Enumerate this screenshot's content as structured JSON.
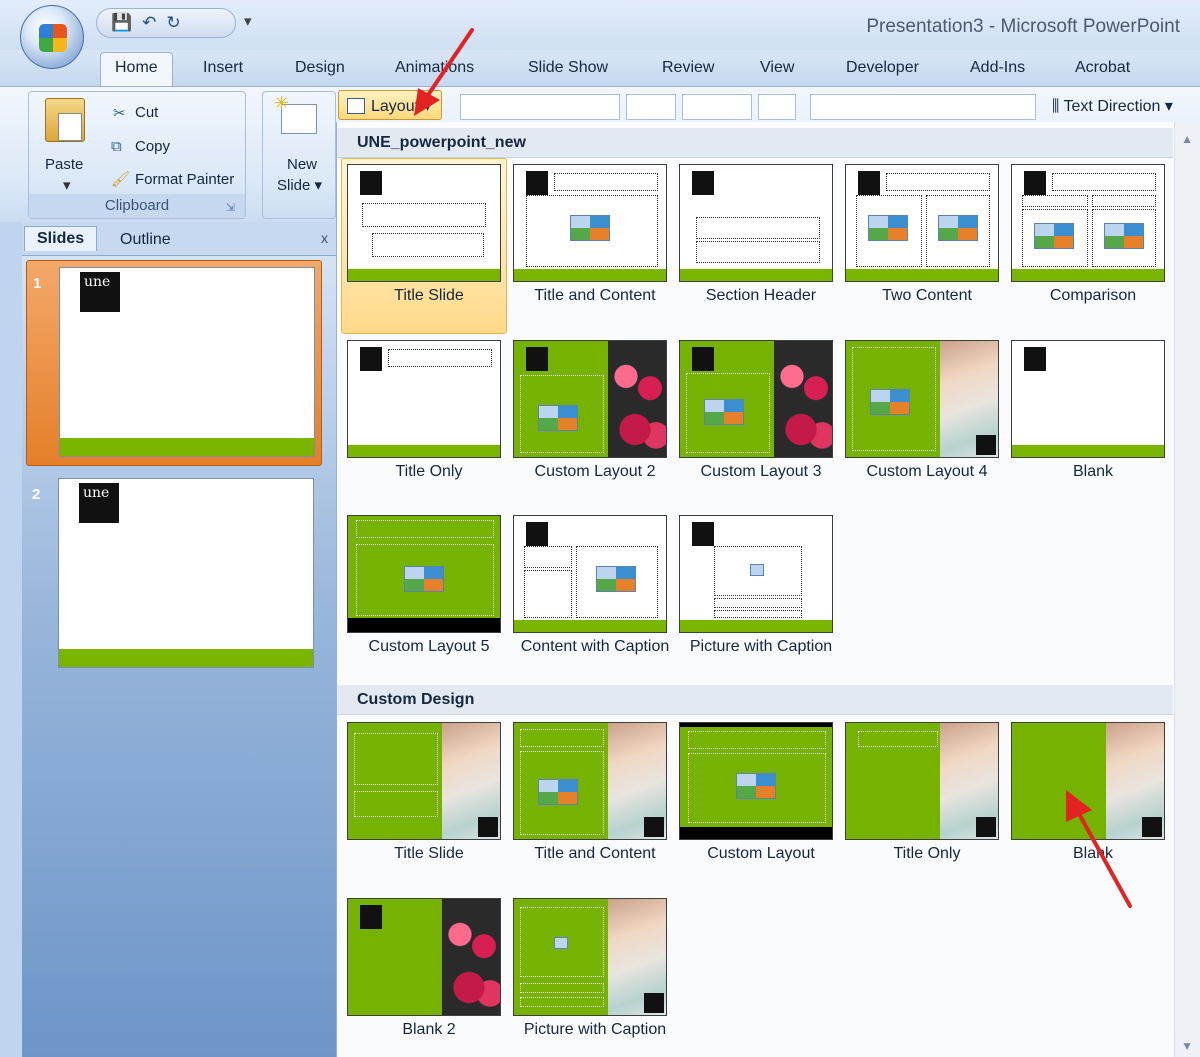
{
  "window": {
    "title": "Presentation3 - Microsoft PowerPoint"
  },
  "quick_access": {
    "save_icon": "save-icon",
    "undo_icon": "undo-icon",
    "redo_icon": "redo-icon",
    "customize": "▾"
  },
  "ribbon": {
    "tabs": [
      "Home",
      "Insert",
      "Design",
      "Animations",
      "Slide Show",
      "Review",
      "View",
      "Developer",
      "Add-Ins",
      "Acrobat"
    ],
    "active_tab": "Home",
    "clipboard": {
      "paste": "Paste",
      "cut": "Cut",
      "copy": "Copy",
      "format_painter": "Format Painter",
      "group_label": "Clipboard"
    },
    "slides": {
      "new_slide_line1": "New",
      "new_slide_line2": "Slide ▾",
      "layout": "Layout ▾"
    },
    "paragraph": {
      "text_direction": "Text Direction ▾"
    }
  },
  "pane": {
    "tabs": [
      "Slides",
      "Outline"
    ],
    "close": "x",
    "slides": [
      {
        "number": "1",
        "logo_text": "une"
      },
      {
        "number": "2",
        "logo_text": "une"
      }
    ]
  },
  "gallery": {
    "sections": [
      {
        "title": "UNE_powerpoint_new",
        "layouts": [
          "Title Slide",
          "Title and Content",
          "Section Header",
          "Two Content",
          "Comparison",
          "Title Only",
          "Custom Layout 2",
          "Custom Layout 3",
          "Custom Layout 4",
          "Blank",
          "Custom Layout 5",
          "Content with Caption",
          "Picture with Caption"
        ]
      },
      {
        "title": "Custom Design",
        "layouts": [
          "Title Slide",
          "Title and Content",
          "Custom Layout",
          "Title Only",
          "Blank",
          "Blank 2",
          "Picture with Caption"
        ]
      }
    ],
    "selected": "Title Slide"
  },
  "colors": {
    "accent_green": "#7ab600",
    "selection_orange": "#e57f29",
    "annotation_red": "#e32222"
  }
}
